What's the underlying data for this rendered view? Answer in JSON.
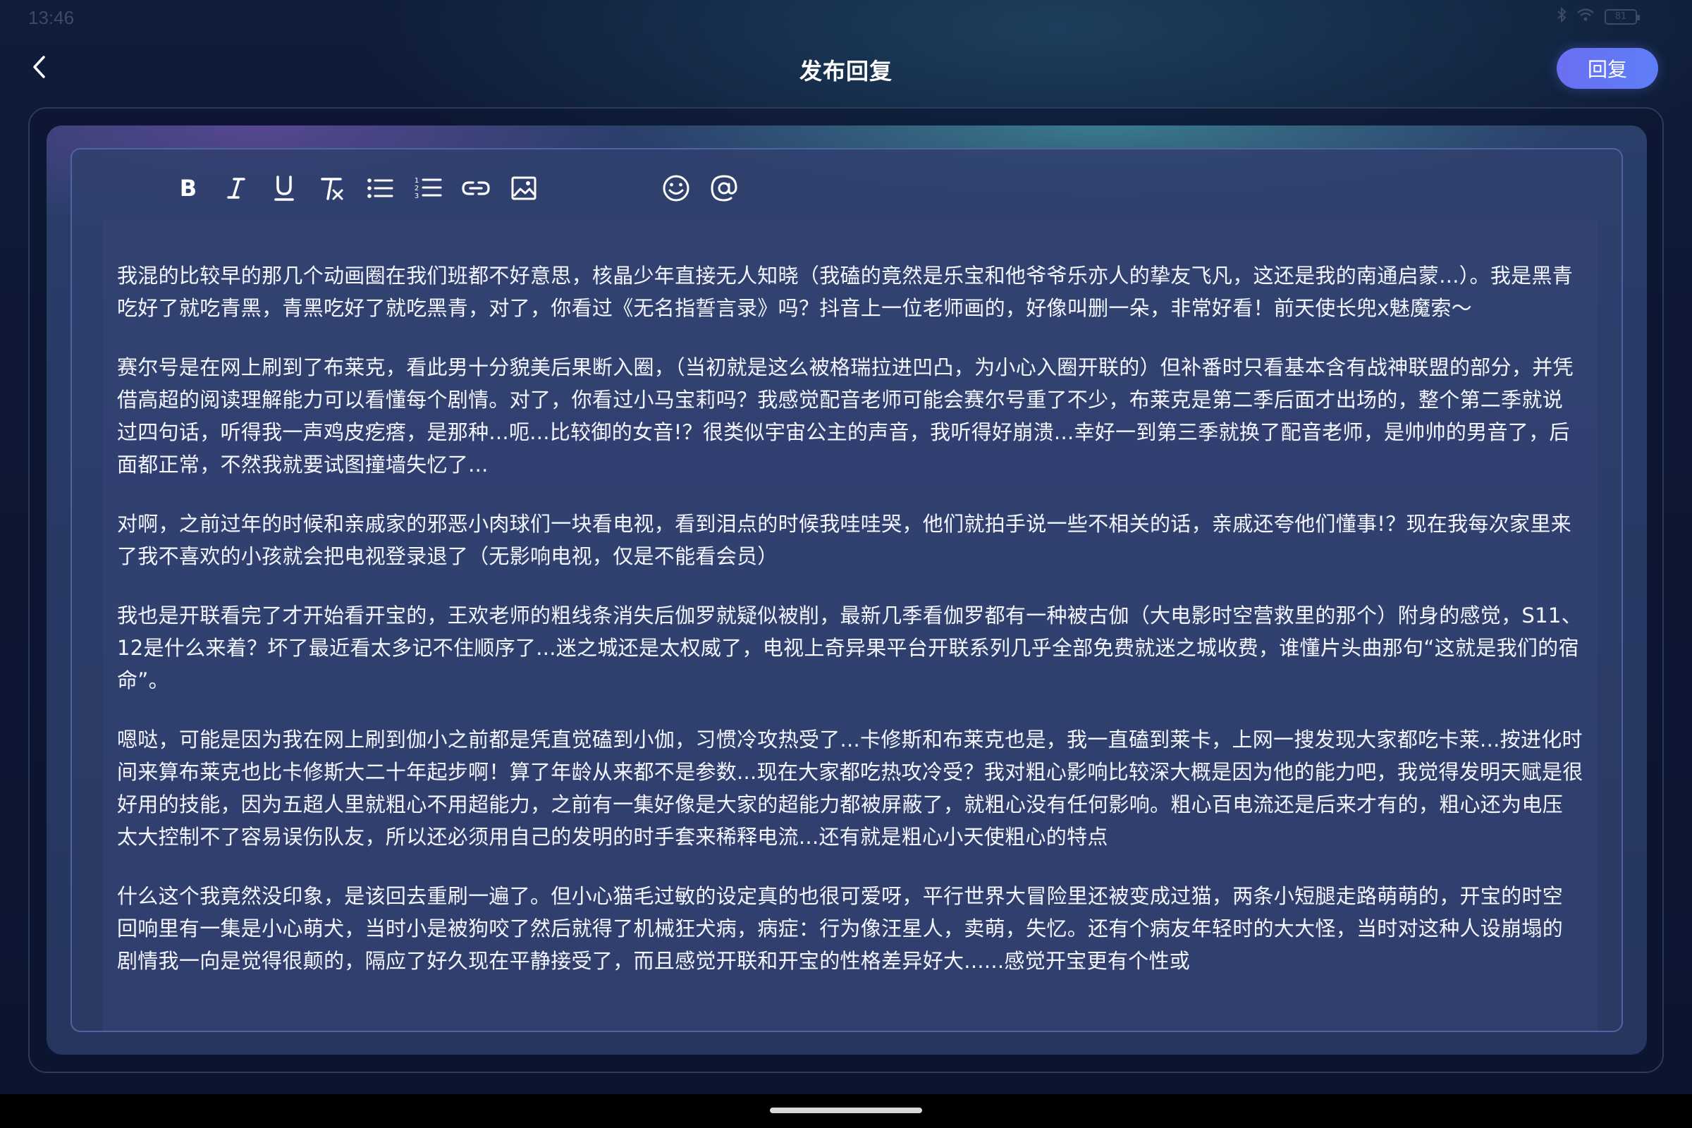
{
  "status_bar": {
    "time": "13:46",
    "battery": "81"
  },
  "header": {
    "title": "发布回复",
    "reply_label": "回复"
  },
  "toolbar": {
    "items": [
      {
        "name": "bold-icon"
      },
      {
        "name": "italic-icon"
      },
      {
        "name": "underline-icon"
      },
      {
        "name": "clear-format-icon"
      },
      {
        "name": "bullet-list-icon"
      },
      {
        "name": "numbered-list-icon"
      },
      {
        "name": "link-icon"
      },
      {
        "name": "image-icon"
      },
      {
        "name": "emoji-icon"
      },
      {
        "name": "mention-icon"
      }
    ]
  },
  "editor": {
    "paragraphs": [
      "我混的比较早的那几个动画圈在我们班都不好意思，核晶少年直接无人知晓（我磕的竟然是乐宝和他爷爷乐亦人的挚友飞凡，这还是我的南通启蒙...）。我是黑青吃好了就吃青黑，青黑吃好了就吃黑青，对了，你看过《无名指誓言录》吗？抖音上一位老师画的，好像叫删一朵，非常好看！前天使长兜x魅魔索～",
      "赛尔号是在网上刷到了布莱克，看此男十分貌美后果断入圈，（当初就是这么被格瑞拉进凹凸，为小心入圈开联的）但补番时只看基本含有战神联盟的部分，并凭借高超的阅读理解能力可以看懂每个剧情。对了，你看过小马宝莉吗？我感觉配音老师可能会赛尔号重了不少，布莱克是第二季后面才出场的，整个第二季就说过四句话，听得我一声鸡皮疙瘩，是那种...呃...比较御的女音!？很类似宇宙公主的声音，我听得好崩溃...幸好一到第三季就换了配音老师，是帅帅的男音了，后面都正常，不然我就要试图撞墙失忆了...",
      "对啊，之前过年的时候和亲戚家的邪恶小肉球们一块看电视，看到泪点的时候我哇哇哭，他们就拍手说一些不相关的话，亲戚还夸他们懂事!？现在我每次家里来了我不喜欢的小孩就会把电视登录退了（无影响电视，仅是不能看会员）",
      "我也是开联看完了才开始看开宝的，王欢老师的粗线条消失后伽罗就疑似被削，最新几季看伽罗都有一种被古伽（大电影时空营救里的那个）附身的感觉，S11、12是什么来着？坏了最近看太多记不住顺序了...迷之城还是太权威了，电视上奇异果平台开联系列几乎全部免费就迷之城收费，谁懂片头曲那句“这就是我们的宿命”。",
      "嗯哒，可能是因为我在网上刷到伽小之前都是凭直觉磕到小伽，习惯冷攻热受了...卡修斯和布莱克也是，我一直磕到莱卡，上网一搜发现大家都吃卡莱...按进化时间来算布莱克也比卡修斯大二十年起步啊！算了年龄从来都不是参数...现在大家都吃热攻冷受？我对粗心影响比较深大概是因为他的能力吧，我觉得发明天赋是很好用的技能，因为五超人里就粗心不用超能力，之前有一集好像是大家的超能力都被屏蔽了，就粗心没有任何影响。粗心百电流还是后来才有的，粗心还为电压太大控制不了容易误伤队友，所以还必须用自己的发明的时手套来稀释电流...还有就是粗心小天使粗心的特点",
      "什么这个我竟然没印象，是该回去重刷一遍了。但小心猫毛过敏的设定真的也很可爱呀，平行世界大冒险里还被变成过猫，两条小短腿走路萌萌的，开宝的时空回响里有一集是小心萌犬，当时小是被狗咬了然后就得了机械狂犬病，病症：行为像汪星人，卖萌，失忆。还有个病友年轻时的大大怪，当时对这种人设崩塌的剧情我一向是觉得很颠的，隔应了好久现在平静接受了，而且感觉开联和开宝的性格差异好大......感觉开宝更有个性或"
    ]
  },
  "colors": {
    "accent": "#6a6ff2",
    "background": "#0d1530",
    "editor_border": "#4f63a0",
    "text": "#f4f6ff"
  }
}
